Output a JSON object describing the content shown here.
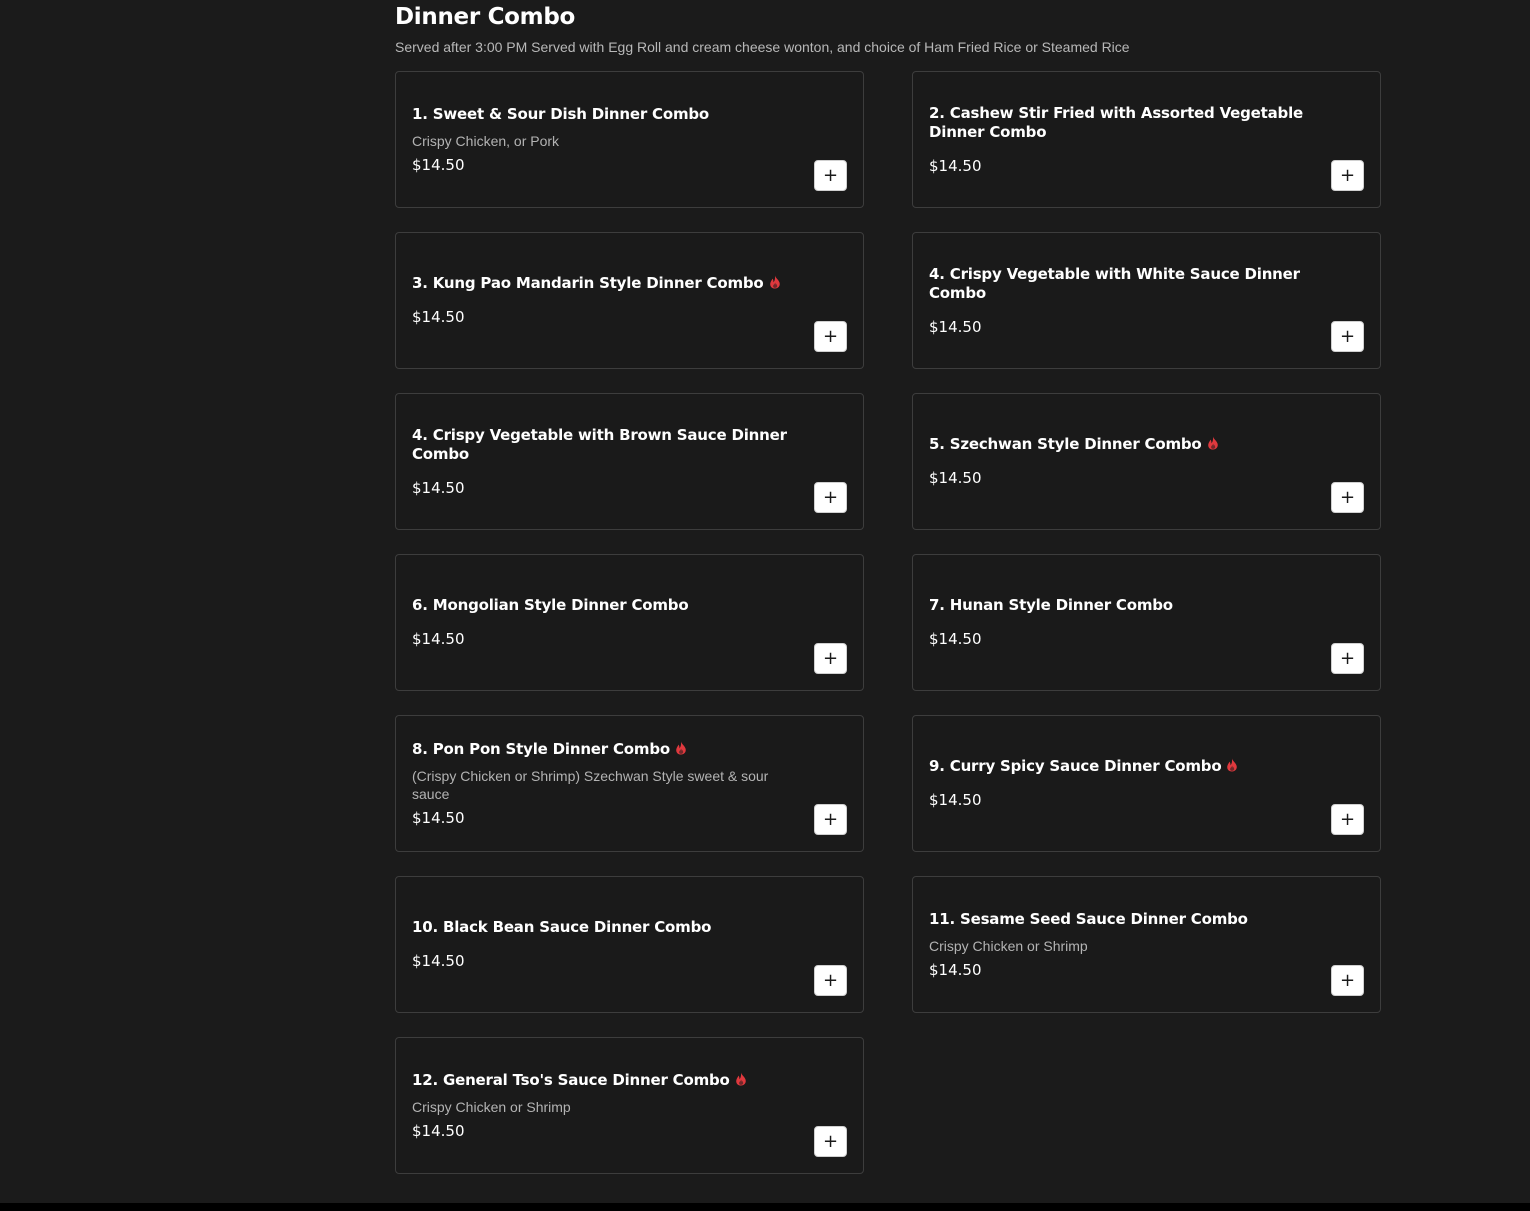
{
  "section": {
    "title": "Dinner Combo",
    "subtitle": "Served after 3:00 PM Served with Egg Roll and cream cheese wonton, and choice of Ham Fried Rice or Steamed Rice"
  },
  "colors": {
    "background": "#1b1b1b",
    "card_border": "#3d3d3d",
    "spicy": "#e0393e"
  },
  "add_label": "+",
  "items": [
    {
      "name": "1. Sweet & Sour Dish Dinner Combo",
      "desc": "Crispy Chicken, or Pork",
      "price": "$14.50",
      "spicy": false
    },
    {
      "name": "2. Cashew Stir Fried with Assorted Vegetable Dinner Combo",
      "desc": "",
      "price": "$14.50",
      "spicy": false
    },
    {
      "name": "3. Kung Pao Mandarin Style Dinner Combo",
      "desc": "",
      "price": "$14.50",
      "spicy": true
    },
    {
      "name": "4. Crispy Vegetable with White Sauce Dinner Combo",
      "desc": "",
      "price": "$14.50",
      "spicy": false
    },
    {
      "name": "4. Crispy Vegetable with Brown Sauce Dinner Combo",
      "desc": "",
      "price": "$14.50",
      "spicy": false
    },
    {
      "name": "5. Szechwan Style Dinner Combo",
      "desc": "",
      "price": "$14.50",
      "spicy": true
    },
    {
      "name": "6. Mongolian Style Dinner Combo",
      "desc": "",
      "price": "$14.50",
      "spicy": false
    },
    {
      "name": "7. Hunan Style Dinner Combo",
      "desc": "",
      "price": "$14.50",
      "spicy": false
    },
    {
      "name": "8. Pon Pon Style Dinner Combo",
      "desc": "(Crispy Chicken or Shrimp) Szechwan Style sweet & sour sauce",
      "price": "$14.50",
      "spicy": true
    },
    {
      "name": "9. Curry Spicy Sauce Dinner Combo",
      "desc": "",
      "price": "$14.50",
      "spicy": true
    },
    {
      "name": "10. Black Bean Sauce Dinner Combo",
      "desc": "",
      "price": "$14.50",
      "spicy": false
    },
    {
      "name": "11. Sesame Seed Sauce Dinner Combo",
      "desc": "Crispy Chicken or Shrimp",
      "price": "$14.50",
      "spicy": false
    },
    {
      "name": "12. General Tso's Sauce Dinner Combo",
      "desc": "Crispy Chicken or Shrimp",
      "price": "$14.50",
      "spicy": true
    }
  ]
}
